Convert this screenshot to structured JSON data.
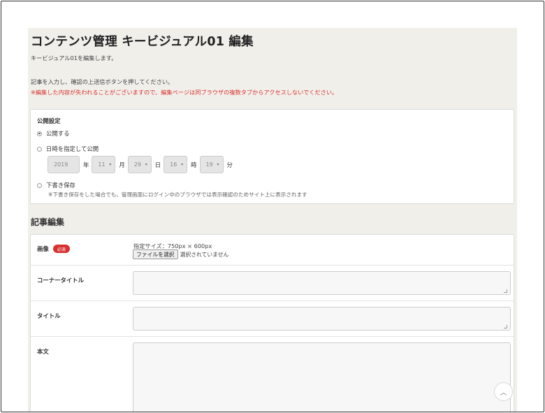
{
  "page": {
    "title": "コンテンツ管理 キービジュアル01 編集",
    "lead": "キービジュアル01を編集します。",
    "instruction": "記事を入力し、確認の上送信ボタンを押してください。",
    "warning": "※編集した内容が失われることがございますので、編集ページは同ブラウザの複数タブからアクセスしないでください。"
  },
  "publish": {
    "title": "公開設定",
    "options": [
      {
        "label": "公開する",
        "checked": true
      },
      {
        "label": "日時を指定して公開",
        "checked": false
      },
      {
        "label": "下書き保存",
        "checked": false
      }
    ],
    "datetime": {
      "year": "2019",
      "year_unit": "年",
      "month": "11",
      "month_unit": "月",
      "day": "29",
      "day_unit": "日",
      "hour": "16",
      "hour_unit": "時",
      "minute": "19",
      "minute_unit": "分"
    },
    "draft_note": "※下書き保存をした場合でも、管理画面にログイン中のブラウザでは表示確認のためサイト上に表示されます"
  },
  "editor": {
    "section_title": "記事編集",
    "image": {
      "label": "画像",
      "required_badge": "必須",
      "size_note": "指定サイズ：750px × 600px",
      "file_button": "ファイルを選択",
      "file_status": "選択されていません"
    },
    "corner_title": {
      "label": "コーナータイトル",
      "value": ""
    },
    "article_title": {
      "label": "タイトル",
      "value": ""
    },
    "body": {
      "label": "本文",
      "value": ""
    }
  },
  "icons": {
    "select_arrow": "▾",
    "scroll_top": "︿"
  },
  "colors": {
    "warning": "#d7312f",
    "required_badge": "#d7312f",
    "page_background": "#f1efea"
  }
}
